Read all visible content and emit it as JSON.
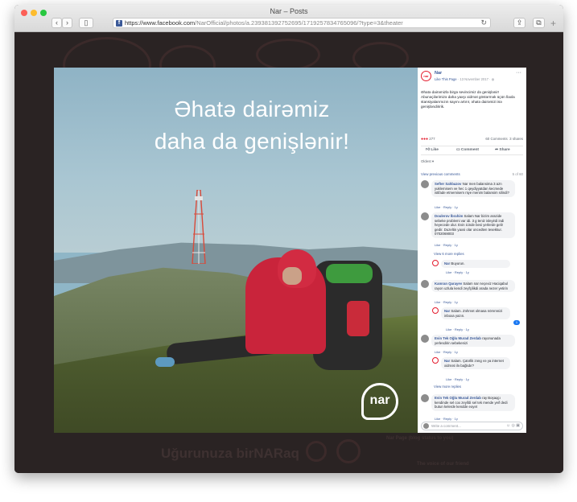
{
  "window": {
    "title": "Nar – Posts",
    "url_host": "https://www.facebook.com",
    "url_path": "/NarOfficial/photos/a.239381392752695/1719257834765096/?type=3&theater",
    "fb_icon": "f"
  },
  "photo": {
    "headline_line1": "Əhatə dairəmiz",
    "headline_line2": "daha da genişlənir!",
    "logo_text": "nar"
  },
  "background": {
    "text1": "Uğurunuza birNARaq",
    "text2": "Nar Page (blog status to you)",
    "text3": "The voice of our friend"
  },
  "post": {
    "page_name": "Nar",
    "like_page": "Like This Page",
    "date": "13 November 2017",
    "text": "Əhatə dairəmizlə birgə sevincimiz də genişlənir! Abunəçilərimizə daha yaxşı xidmət göstərmək üçün İlaxla stansiyalarımızın sayını artırır, əhatə dairəmizi isə genişləndiririk.",
    "reaction_count": "277",
    "comment_count": "60 Comments",
    "share_count": "3 shares",
    "like_label": "Like",
    "comment_label": "Comment",
    "share_label": "Share",
    "sort_label": "Oldest ▾",
    "view_previous": "View previous comments",
    "counter": "5 of 60",
    "write_placeholder": "Write a comment...",
    "view_more_replies": "View 6 more replies",
    "view_more_replies2": "View more replies"
  },
  "comments": [
    {
      "name": "Sefter Sahbazov",
      "text": "Nar men balansima 3 azn yuklemisem ve hec 1 qeydiyyatdan kecmede istifade etmemisem niye menim balansim silindi?",
      "meta": "Like · Reply · 1y"
    },
    {
      "name": "Doulerov İbrahim",
      "text": "Salam Nar bizim arazide sebeke problemi var idi. 3 g teniz isleyirdi indi heyecede olur. Evin icinde besi yerlerde gelir gedir. Duzeltin yaxsi olar oncedten tesekkur. 0702069003",
      "meta": "Like · Reply · 1y"
    },
    {
      "name": "Nar",
      "text": "Buyurun.",
      "meta": "Like · Reply · 1y"
    },
    {
      "name": "Kamran Qarayev",
      "text": "Salam nar neçexiz Haciqabul rayon uzlula kendi zeyfçilikdi arada nezer yetirin",
      "meta": "Like · Reply · 1y"
    },
    {
      "name": "Nar",
      "text": "Salam. Zəhmət olmasa nömrənizi inboxa yazın.",
      "meta": "Like · Reply · 1y"
    },
    {
      "name": "Evin Tek Oğlu Murad Zerdab",
      "text": "rayonunada yerlesdirin sebekenizi",
      "meta": "Like · Reply · 1y"
    },
    {
      "name": "Nar",
      "text": "Salam. Çatırlik zəng və ya internet xidməti ilə bağlıdır?",
      "meta": "Like · Reply · 1y"
    },
    {
      "name": "Evin Tek Oğlu Murad Zerdab",
      "text": "ray Boşaqçı kendinde sel cox zeyifdi sel tek mende yeif dedi butun kelerde kendde eoyet",
      "meta": "Like · Reply · 1y"
    }
  ],
  "colors": {
    "brand_red": "#e41b2d",
    "fb_blue": "#385898",
    "page_bg": "#2a2323"
  }
}
